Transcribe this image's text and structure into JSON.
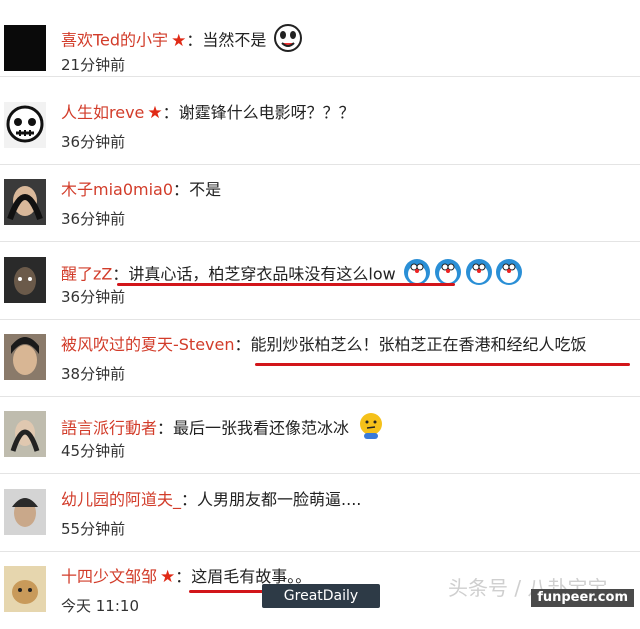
{
  "comments": [
    {
      "user": "喜欢Ted的小宇",
      "star": "★",
      "sep": "：",
      "text": "当然不是",
      "time": "21分钟前"
    },
    {
      "user": "人生如reve",
      "star": "★",
      "sep": "：",
      "text": "谢霆锋什么电影呀？？？",
      "time": "36分钟前"
    },
    {
      "user": "木子mia0mia0",
      "sep": "：",
      "text": "不是",
      "time": "36分钟前"
    },
    {
      "user": "醒了zZ",
      "sep": "：",
      "text": "讲真心话，柏芝穿衣品味没有这么low",
      "time": "36分钟前"
    },
    {
      "user": "被风吹过的夏天-Steven",
      "sep": "：",
      "text": "能别炒张柏芝么！张柏芝正在香港和经纪人吃饭",
      "time": "38分钟前"
    },
    {
      "user": "語言派行動者",
      "sep": "：",
      "text": "最后一张我看还像范冰冰",
      "time": "45分钟前"
    },
    {
      "user": "幼儿园的阿道夫_",
      "sep": "：",
      "text": "人男朋友都一脸萌逼....",
      "time": "55分钟前"
    },
    {
      "user": "十四少文邹邹",
      "star": "★",
      "sep": "：",
      "text": "这眉毛有故事。。",
      "time": "今天 11:10"
    }
  ],
  "watermarks": {
    "badge": "GreatDaily",
    "site": "funpeer.com",
    "toutiao": "头条号 / 八卦宝宝"
  },
  "colors": {
    "username": "#d23c2a",
    "underline": "#d2151a",
    "star": "#e02a16"
  }
}
